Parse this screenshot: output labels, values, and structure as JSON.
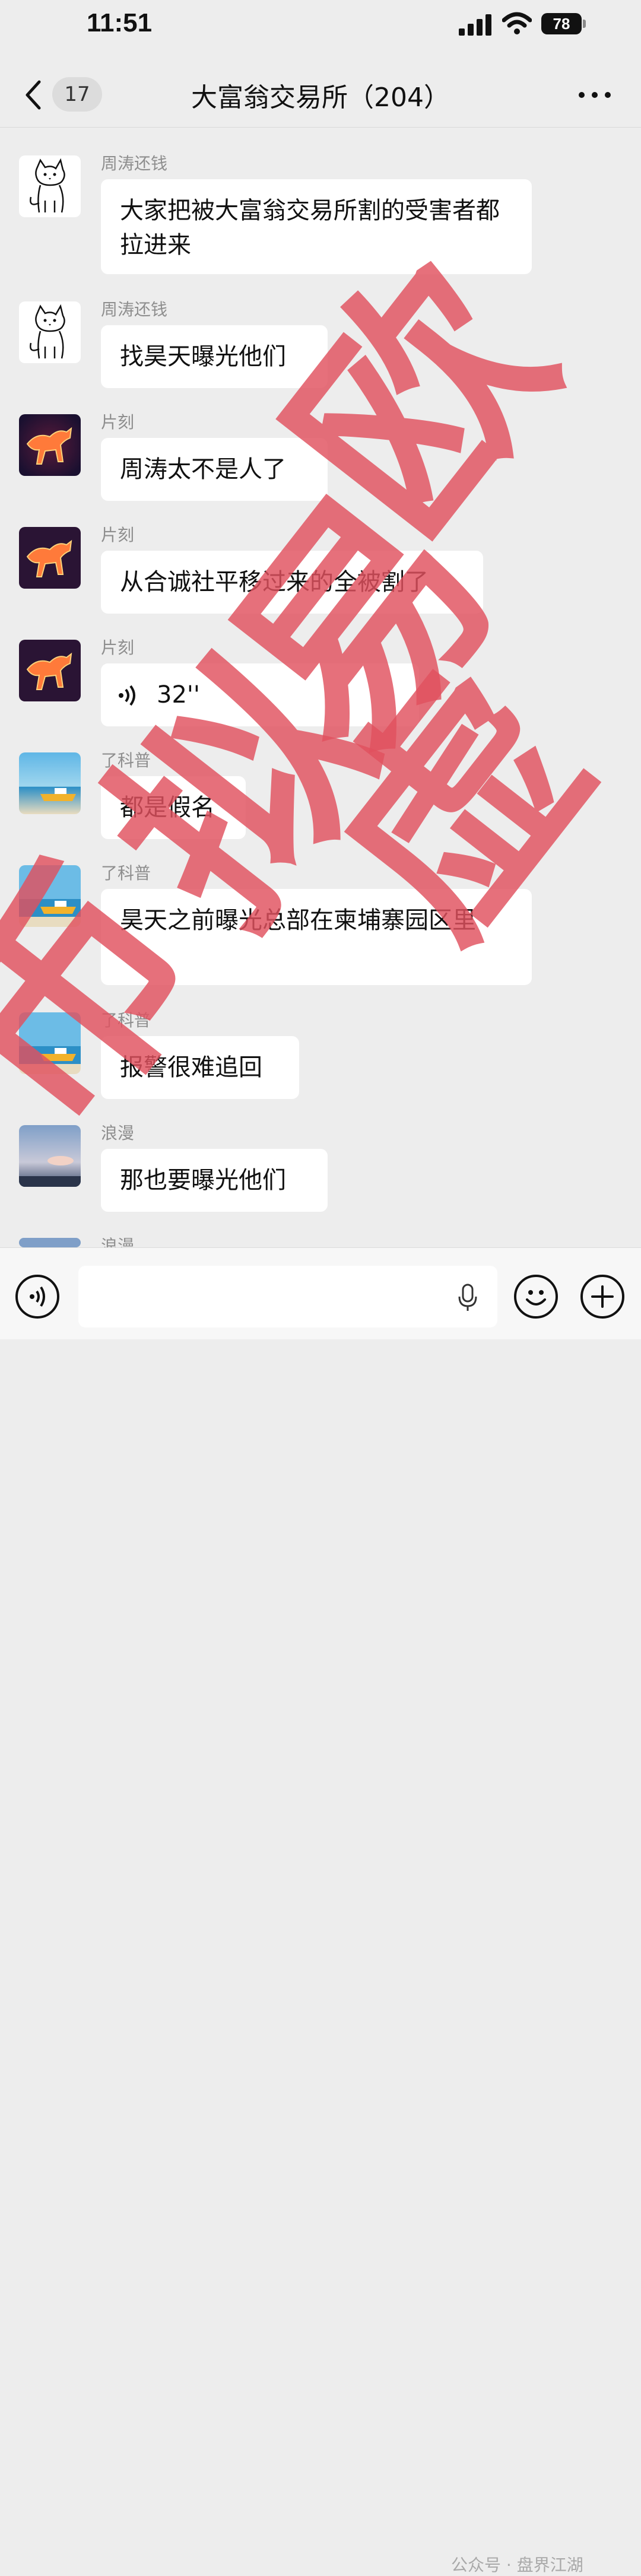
{
  "status_bar": {
    "time": "11:51",
    "battery": "78"
  },
  "nav": {
    "unread_count": "17",
    "title": "大富翁交易所（204）"
  },
  "messages": [
    {
      "sender": "周涛还钱",
      "text": "大家把被大富翁交易所割的受害者都拉进来",
      "avatar": "cat-sketch"
    },
    {
      "sender": "周涛还钱",
      "text": "找昊天曝光他们",
      "avatar": "cat-sketch"
    },
    {
      "sender": "片刻",
      "text": "周涛太不是人了",
      "avatar": "fire-horse"
    },
    {
      "sender": "片刻",
      "text": "从合诚社平移过来的全被割了",
      "avatar": "fire-horse"
    },
    {
      "sender": "片刻",
      "text": "32''",
      "type": "voice",
      "avatar": "fire-horse"
    },
    {
      "sender": "了科普",
      "text": "都是假名",
      "avatar": "yellow-boat"
    },
    {
      "sender": "了科普",
      "text": "昊天之前曝光总部在柬埔寨园区里",
      "avatar": "yellow-boat"
    },
    {
      "sender": "了科普",
      "text": "报警很难追回",
      "avatar": "yellow-boat"
    },
    {
      "sender": "浪漫",
      "text": "那也要曝光他们",
      "avatar": "sunset-sky"
    },
    {
      "sender": "浪漫",
      "text": "",
      "avatar": "sunset-sky"
    }
  ],
  "stamp": {
    "text": "欧易虚拟币",
    "color": "#e0505e"
  },
  "watermark": "公众号 · 盘界江湖",
  "colors": {
    "background": "#ededed",
    "bubble": "#ffffff",
    "sender": "#8e8e8e"
  }
}
